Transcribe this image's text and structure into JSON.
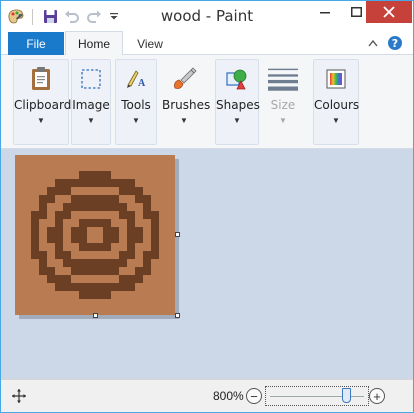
{
  "window": {
    "title": "wood - Paint",
    "accent": "#1979ca",
    "close_color": "#c7413b"
  },
  "quick_access": {
    "icons": [
      "paint-app-icon",
      "save-icon",
      "undo-icon",
      "redo-icon",
      "customize-quick-access-icon"
    ]
  },
  "tabs": {
    "file": "File",
    "home": "Home",
    "view": "View"
  },
  "ribbon": {
    "groups": [
      {
        "label": "Clipboard",
        "icon": "clipboard-icon",
        "enabled": true
      },
      {
        "label": "Image",
        "icon": "image-select-icon",
        "enabled": true
      },
      {
        "label": "Tools",
        "icon": "tools-icon",
        "enabled": true
      },
      {
        "label": "Brushes",
        "icon": "brush-icon",
        "enabled": true
      },
      {
        "label": "Shapes",
        "icon": "shapes-icon",
        "enabled": true
      },
      {
        "label": "Size",
        "icon": "size-icon",
        "enabled": false
      },
      {
        "label": "Colours",
        "icon": "colours-icon",
        "enabled": true
      }
    ],
    "dropdown_glyph": "▼"
  },
  "canvas": {
    "background_color": "#b87b52",
    "pattern_color": "#6a3f24",
    "pixel_rows": [
      "....................",
      "....................",
      "........XXXX........",
      ".....XXXXXXXXXX.....",
      "....XXX......XXX....",
      "...XX..XXXXXX..XX...",
      "...X..XXXXXXXX..X...",
      "..XX.XX......XX.XX..",
      "..X..X..XXXX..X..X..",
      "..X.XX.XX..XX.XX.X..",
      "..X.XX.XX..XX.XX.X..",
      "..X..X..XXXX..X..X..",
      "..XX.XX......XX.XX..",
      "...X..XXXXXXXX..X...",
      "...XX..XXXXXX..XX...",
      "....XXX......XXX....",
      ".....XXXXXXXXXX.....",
      "........XXXX........",
      "....................",
      "...................."
    ]
  },
  "statusbar": {
    "zoom_level": "800%",
    "zoom_out": "−",
    "zoom_in": "+",
    "zoom_fraction": 0.82
  }
}
